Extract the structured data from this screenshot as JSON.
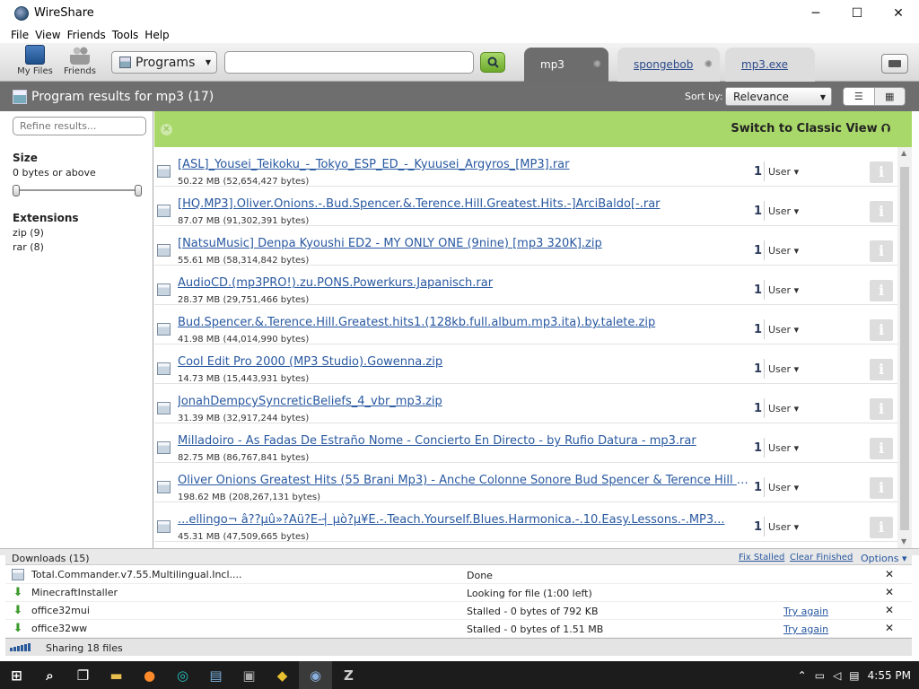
{
  "window": {
    "title": "WireShare",
    "minimize": "─",
    "maximize": "☐",
    "close": "✕"
  },
  "menu": [
    "File",
    "View",
    "Friends",
    "Tools",
    "Help"
  ],
  "toolbar": {
    "my_files": "My Files",
    "friends": "Friends",
    "category": "Programs",
    "search_value": "",
    "search_icon": "search-icon",
    "tabs": [
      {
        "label": "mp3",
        "active": true
      },
      {
        "label": "spongebob",
        "active": false
      },
      {
        "label": "mp3.exe",
        "active": false
      }
    ]
  },
  "results_header": {
    "title": "Program results for mp3 (17)",
    "sort_label": "Sort by:",
    "sort_value": "Relevance"
  },
  "sidebar": {
    "refine_placeholder": "Refine results...",
    "size_heading": "Size",
    "size_value": "0 bytes or above",
    "extensions_heading": "Extensions",
    "extensions": [
      "zip (9)",
      "rar (8)"
    ]
  },
  "banner": {
    "switch_label": "Switch to Classic View",
    "arrow": "⮉"
  },
  "results": [
    {
      "name": "[ASL]_Yousei_Teikoku_-_Tokyo_ESP_ED_-_Kyuusei_Argyros_[MP3].rar",
      "size": "50.22 MB (52,654,427 bytes)",
      "count": "1",
      "user": "User ▾"
    },
    {
      "name": "[HQ.MP3].Oliver.Onions.-.Bud.Spencer.&.Terence.Hill.Greatest.Hits.-]ArciBaldo[-.rar",
      "size": "87.07 MB (91,302,391 bytes)",
      "count": "1",
      "user": "User ▾"
    },
    {
      "name": "[NatsuMusic] Denpa Kyoushi ED2 - MY ONLY ONE (9nine) [mp3 320K].zip",
      "size": "55.61 MB (58,314,842 bytes)",
      "count": "1",
      "user": "User ▾"
    },
    {
      "name": "AudioCD.(mp3PRO!).zu.PONS.Powerkurs.Japanisch.rar",
      "size": "28.37 MB (29,751,466 bytes)",
      "count": "1",
      "user": "User ▾"
    },
    {
      "name": "Bud.Spencer.&.Terence.Hill.Greatest.hits1.(128kb.full.album.mp3.ita).by.talete.zip",
      "size": "41.98 MB (44,014,990 bytes)",
      "count": "1",
      "user": "User ▾"
    },
    {
      "name": "Cool Edit Pro 2000 (MP3 Studio).Gowenna.zip",
      "size": "14.73 MB (15,443,931 bytes)",
      "count": "1",
      "user": "User ▾"
    },
    {
      "name": "JonahDempcySyncreticBeliefs_4_vbr_mp3.zip",
      "size": "31.39 MB (32,917,244 bytes)",
      "count": "1",
      "user": "User ▾"
    },
    {
      "name": "Milladoiro - As Fadas De Estraño Nome - Concierto En Directo - by Rufio Datura - mp3.rar",
      "size": "82.75 MB (86,767,841 bytes)",
      "count": "1",
      "user": "User ▾"
    },
    {
      "name": "Oliver Onions Greatest Hits (55 Brani Mp3) - Anche Colonne Sonore Bud Spencer & Terence Hill E...",
      "size": "198.62 MB (208,267,131 bytes)",
      "count": "1",
      "user": "User ▾"
    },
    {
      "name": "...ellingo¬ â??µû»?Äü?Ë-┤ µò?µ¥É.-.Teach.Yourself.Blues.Harmonica.-.10.Easy.Lessons.-.MP3...",
      "size": "45.31 MB (47,509,665 bytes)",
      "count": "1",
      "user": "User ▾"
    }
  ],
  "downloads": {
    "title": "Downloads (15)",
    "fix_stalled": "Fix Stalled",
    "clear_finished": "Clear Finished",
    "options": "Options ▾",
    "items": [
      {
        "name": "Total.Commander.v7.55.Multilingual.Incl....",
        "status": "Done",
        "action": "",
        "icon": "window-icon"
      },
      {
        "name": "MinecraftInstaller",
        "status": "Looking for file (1:00 left)",
        "action": "",
        "icon": "download-arrow-icon"
      },
      {
        "name": "office32mui",
        "status": "Stalled - 0 bytes of 792 KB",
        "action": "Try again",
        "icon": "download-arrow-icon"
      },
      {
        "name": "office32ww",
        "status": "Stalled - 0 bytes of 1.51 MB",
        "action": "Try again",
        "icon": "download-arrow-icon"
      }
    ]
  },
  "status": {
    "sharing": "Sharing 18 files"
  },
  "taskbar": {
    "time": "4:55 PM"
  }
}
